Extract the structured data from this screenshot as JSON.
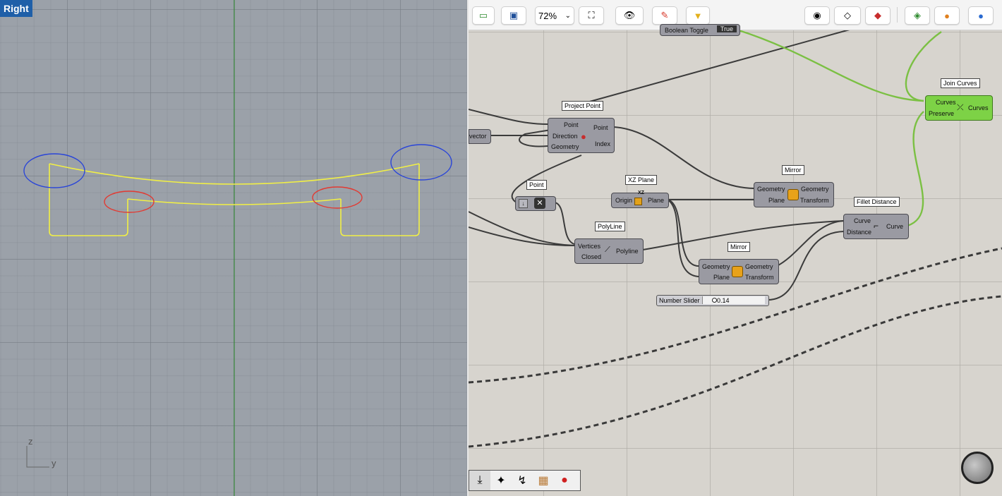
{
  "viewport": {
    "title": "Right",
    "axis_z": "z",
    "axis_y": "y",
    "colors": {
      "background": "#9ba1a9",
      "curve": "#f1ef45",
      "highlight_blue": "#2a45d8",
      "highlight_red": "#e23a32",
      "axis_green": "#2c8a2c"
    }
  },
  "toolbar": {
    "zoom": "72%",
    "buttons": [
      "open-icon",
      "save-icon",
      "zoom-dropdown",
      "zoom-extents-icon",
      "preview-eye-icon",
      "sketch-icon",
      "bake-icon",
      "preview-shaded-icon",
      "wireframe-icon",
      "selected-preview-icon",
      "display-mode-icon",
      "material-icon",
      "sphere-icon"
    ]
  },
  "components": {
    "boolean_toggle": {
      "label": "Boolean Toggle",
      "value": "True"
    },
    "project_point": {
      "tag": "Project Point",
      "inputs": [
        "Point",
        "Direction",
        "Geometry"
      ],
      "outputs": [
        "Point",
        "Index"
      ]
    },
    "vector": {
      "label": "vector"
    },
    "point": {
      "tag": "Point"
    },
    "xz_plane": {
      "tag": "XZ Plane",
      "input": "Origin",
      "output": "Plane",
      "badge": "XZ"
    },
    "mirror_1": {
      "tag": "Mirror",
      "inputs": [
        "Geometry",
        "Plane"
      ],
      "outputs": [
        "Geometry",
        "Transform"
      ]
    },
    "mirror_2": {
      "tag": "Mirror",
      "inputs": [
        "Geometry",
        "Plane"
      ],
      "outputs": [
        "Geometry",
        "Transform"
      ]
    },
    "polyline": {
      "tag": "PolyLine",
      "inputs": [
        "Vertices",
        "Closed"
      ],
      "output": "Polyline"
    },
    "fillet": {
      "tag": "Fillet Distance",
      "inputs": [
        "Curve",
        "Distance"
      ],
      "output": "Curve"
    },
    "join": {
      "tag": "Join Curves",
      "inputs": [
        "Curves",
        "Preserve"
      ],
      "output": "Curves"
    },
    "slider": {
      "label": "Number Slider",
      "value": "0.14"
    }
  },
  "bottom_tools": [
    "bake-down-icon",
    "wand-icon",
    "bezier-icon",
    "package-icon",
    "record-icon"
  ],
  "colors": {
    "canvas": "#d7d4ce",
    "component": "#9a9aa2",
    "join_curves": "#7dd246",
    "wire_dark": "#3b3b3b",
    "wire_green": "#7bc043",
    "wire_dashed": "#3a3a3a"
  }
}
